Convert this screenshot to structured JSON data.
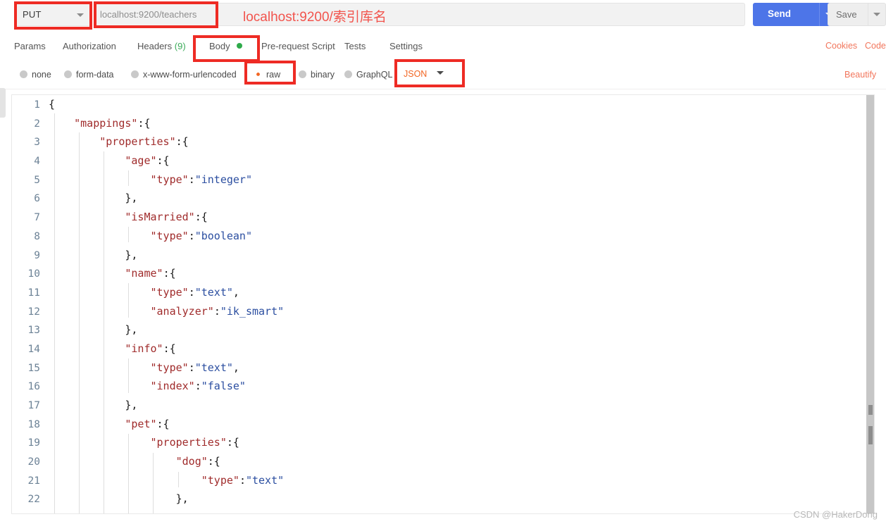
{
  "request_bar": {
    "method": "PUT",
    "method_caret_icon": "chevron-down-icon",
    "url_value": "localhost:9200/teachers",
    "url_placeholder": "Enter request URL",
    "annotation": "localhost:9200/索引库名",
    "send_label": "Send",
    "send_caret_icon": "chevron-down-icon",
    "save_label": "Save",
    "save_caret_icon": "chevron-down-icon"
  },
  "tabs": {
    "items": [
      {
        "label": "Params",
        "active": false
      },
      {
        "label": "Authorization",
        "active": false
      },
      {
        "label": "Headers",
        "count": "(9)",
        "active": false
      },
      {
        "label": "Body",
        "active": true,
        "dot": true
      },
      {
        "label": "Pre-request Script",
        "active": false
      },
      {
        "label": "Tests",
        "active": false
      },
      {
        "label": "Settings",
        "active": false
      }
    ],
    "cookies_label": "Cookies",
    "code_label": "Code"
  },
  "body_types": {
    "options": [
      {
        "label": "none",
        "selected": false
      },
      {
        "label": "form-data",
        "selected": false
      },
      {
        "label": "x-www-form-urlencoded",
        "selected": false
      },
      {
        "label": "raw",
        "selected": true
      },
      {
        "label": "binary",
        "selected": false
      },
      {
        "label": "GraphQL",
        "selected": false
      }
    ],
    "format_label": "JSON",
    "format_caret_icon": "chevron-down-icon",
    "beautify_label": "Beautify"
  },
  "editor": {
    "lines": [
      {
        "n": "1",
        "indent": 0,
        "text": "{"
      },
      {
        "n": "2",
        "indent": 1,
        "text": "\"mappings\":{"
      },
      {
        "n": "3",
        "indent": 2,
        "text": "\"properties\":{"
      },
      {
        "n": "4",
        "indent": 3,
        "text": "\"age\":{"
      },
      {
        "n": "5",
        "indent": 4,
        "text": "\"type\":\"integer\""
      },
      {
        "n": "6",
        "indent": 3,
        "text": "},"
      },
      {
        "n": "7",
        "indent": 3,
        "text": "\"isMarried\":{"
      },
      {
        "n": "8",
        "indent": 4,
        "text": "\"type\":\"boolean\""
      },
      {
        "n": "9",
        "indent": 3,
        "text": "},"
      },
      {
        "n": "10",
        "indent": 3,
        "text": "\"name\":{"
      },
      {
        "n": "11",
        "indent": 4,
        "text": "\"type\":\"text\","
      },
      {
        "n": "12",
        "indent": 4,
        "text": "\"analyzer\":\"ik_smart\""
      },
      {
        "n": "13",
        "indent": 3,
        "text": "},"
      },
      {
        "n": "14",
        "indent": 3,
        "text": "\"info\":{"
      },
      {
        "n": "15",
        "indent": 4,
        "text": "\"type\":\"text\","
      },
      {
        "n": "16",
        "indent": 4,
        "text": "\"index\":\"false\""
      },
      {
        "n": "17",
        "indent": 3,
        "text": "},"
      },
      {
        "n": "18",
        "indent": 3,
        "text": "\"pet\":{"
      },
      {
        "n": "19",
        "indent": 4,
        "text": "\"properties\":{"
      },
      {
        "n": "20",
        "indent": 5,
        "text": "\"dog\":{"
      },
      {
        "n": "21",
        "indent": 6,
        "text": "\"type\":\"text\""
      },
      {
        "n": "22",
        "indent": 5,
        "text": "},"
      }
    ]
  },
  "watermark": "CSDN @HakerDong"
}
